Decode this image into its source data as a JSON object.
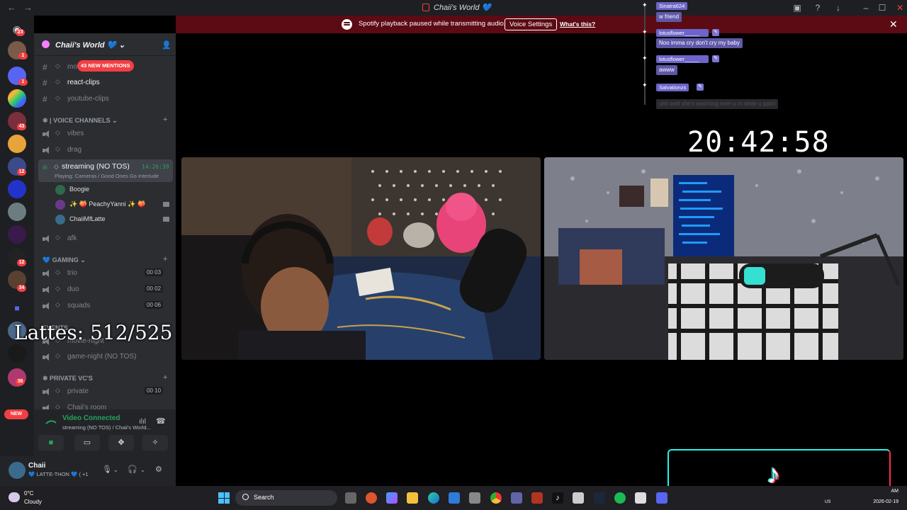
{
  "titlebar": {
    "title": "Chaii's World 💙"
  },
  "banner": {
    "message": "Spotify playback paused while transmitting audio.",
    "button": "Voice Settings",
    "link": "What's this?"
  },
  "rail": {
    "badges": [
      "23",
      "1",
      "1",
      "43",
      "12",
      "12",
      "34",
      "36"
    ],
    "new_label": "NEW"
  },
  "server": {
    "name": "Chaii's World 💙"
  },
  "channels": {
    "mention_pill": "43 NEW MENTIONS",
    "text": [
      {
        "label": "mo"
      },
      {
        "label": "react-clips"
      },
      {
        "label": "youtube-clips"
      }
    ],
    "voice_category": "| VOICE CHANNELS",
    "voice": [
      {
        "label": "vibes"
      },
      {
        "label": "drag"
      }
    ],
    "streaming": {
      "label": "streaming (NO TOS)",
      "timer": "14:26:39",
      "activity": "Playing: Cameras / Good Ones Go Interlude"
    },
    "voice_users": [
      {
        "name": "Boogie"
      },
      {
        "name": "✨ 🍑 PeachyYanni ✨ 🍑"
      },
      {
        "name": "ChaiiMfLatte"
      }
    ],
    "afk": "afk",
    "gaming_category": "GAMING",
    "gaming": [
      {
        "label": "trio",
        "count": "00 03"
      },
      {
        "label": "duo",
        "count": "00 02"
      },
      {
        "label": "squads",
        "count": "00 06"
      }
    ],
    "events_category": "EVENTS",
    "events": [
      {
        "label": "movie-night"
      },
      {
        "label": "game-night (NO TOS)"
      }
    ],
    "private_category": "PRIVATE VC'S",
    "private": [
      {
        "label": "private",
        "count": "00 10"
      },
      {
        "label": "Chaii's room"
      }
    ]
  },
  "overlay_counter": "Lattes: 512/525",
  "voice_panel": {
    "status": "Video Connected",
    "location": "streaming (NO TOS) / Chaii's World..."
  },
  "user_panel": {
    "username": "Chaii",
    "status": "💙 LATTE-THON 💙 (  +1"
  },
  "clock": "20:42:58",
  "chat": [
    {
      "user": "Sinatra624",
      "message": "w friend"
    },
    {
      "user": "lotusflower_____",
      "message": "Noo imma cry don't cry my baby"
    },
    {
      "user": "lotusflower_____",
      "message": "awww"
    },
    {
      "user": "Salvationzs",
      "message": "uhh well she's watching over u rn while u paint"
    }
  ],
  "taskbar": {
    "temp": "0°C",
    "condition": "Cloudy",
    "search": "Search",
    "time": "AM",
    "date": "2026-02-19",
    "tray": "US"
  },
  "colors": {
    "discord_bg": "#2b2d31",
    "rail_bg": "#1e1f22",
    "banner_bg": "#5c0a14",
    "connected_green": "#23a55a",
    "mention_red": "#f23f43",
    "chat_purple": "#6d65c9"
  }
}
